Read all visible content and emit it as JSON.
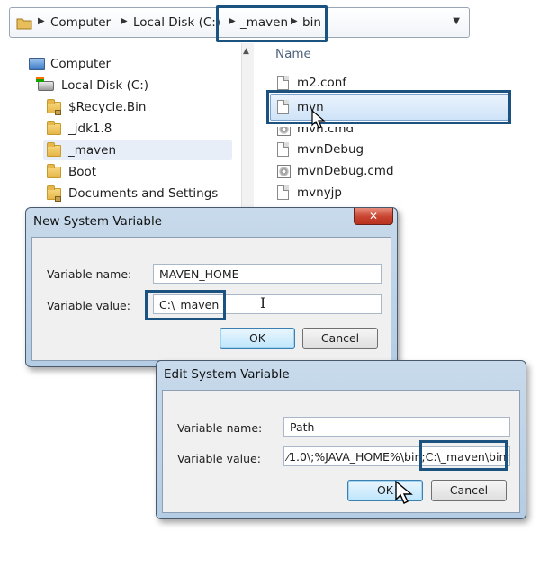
{
  "explorer": {
    "breadcrumbs": [
      "Computer",
      "Local Disk (C:)",
      "_maven",
      "bin"
    ],
    "nav_tree": [
      {
        "label": "Computer",
        "icon": "computer-icon"
      },
      {
        "label": "Local Disk (C:)",
        "icon": "drive-icon"
      },
      {
        "label": "$Recycle.Bin",
        "icon": "locked-folder-icon"
      },
      {
        "label": "_jdk1.8",
        "icon": "folder-icon"
      },
      {
        "label": "_maven",
        "icon": "folder-icon",
        "selected": true
      },
      {
        "label": "Boot",
        "icon": "folder-icon"
      },
      {
        "label": "Documents and Settings",
        "icon": "locked-folder-icon"
      }
    ],
    "column_header": "Name",
    "files": [
      {
        "name": "m2.conf",
        "icon": "document-icon"
      },
      {
        "name": "mvn",
        "icon": "document-icon",
        "selected": true
      },
      {
        "name": "mvn.cmd",
        "icon": "command-file-icon"
      },
      {
        "name": "mvnDebug",
        "icon": "document-icon"
      },
      {
        "name": "mvnDebug.cmd",
        "icon": "command-file-icon"
      },
      {
        "name": "mvnyjp",
        "icon": "document-icon"
      }
    ]
  },
  "new_var_dialog": {
    "title": "New System Variable",
    "name_label": "Variable name:",
    "name_value": "MAVEN_HOME",
    "value_label": "Variable value:",
    "value_value": "C:\\_maven",
    "ok": "OK",
    "cancel": "Cancel"
  },
  "edit_var_dialog": {
    "title": "Edit System Variable",
    "name_label": "Variable name:",
    "name_value": "Path",
    "value_label": "Variable value:",
    "value_value_visible": "⁄1.0\\;%JAVA_HOME%\\bin;",
    "value_value_highlight": "C:\\_maven\\bin;",
    "ok": "OK",
    "cancel": "Cancel"
  },
  "colors": {
    "highlight_border": "#1b5280",
    "title_bar": "#c8daeb",
    "close_button": "#c7432f",
    "selection": "#cde3f8"
  }
}
